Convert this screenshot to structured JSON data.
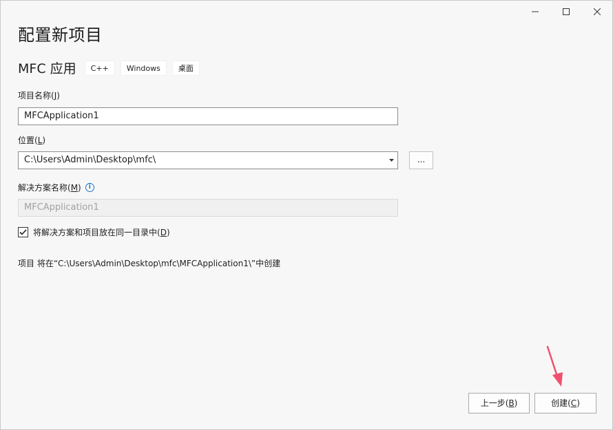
{
  "window": {
    "controls": [
      "minimize-icon",
      "maximize-icon",
      "close-icon"
    ]
  },
  "header": {
    "title": "配置新项目",
    "app_name": "MFC 应用",
    "tags": [
      "C++",
      "Windows",
      "桌面"
    ]
  },
  "project_name": {
    "label": "项目名称(",
    "mnemonic": "J",
    "label_end": ")",
    "value": "MFCApplication1"
  },
  "location": {
    "label": "位置(",
    "mnemonic": "L",
    "label_end": ")",
    "value": "C:\\Users\\Admin\\Desktop\\mfc\\",
    "browse_label": "..."
  },
  "solution_name": {
    "label": "解决方案名称(",
    "mnemonic": "M",
    "label_end": ")",
    "value": "MFCApplication1",
    "info_icon": "i"
  },
  "same_dir": {
    "checked": true,
    "label": "将解决方案和项目放在同一目录中(",
    "mnemonic": "D",
    "label_end": ")"
  },
  "summary": {
    "text": "项目 将在“C:\\Users\\Admin\\Desktop\\mfc\\MFCApplication1\\”中创建"
  },
  "footer": {
    "back_label": "上一步(",
    "back_mnemonic": "B",
    "back_end": ")",
    "create_label": "创建(",
    "create_mnemonic": "C",
    "create_end": ")"
  },
  "colors": {
    "annotation_arrow": "#f0506e",
    "accent": "#1a73c8"
  }
}
